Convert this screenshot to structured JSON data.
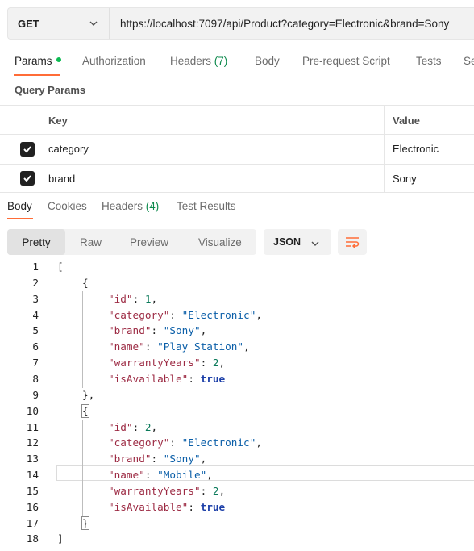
{
  "request": {
    "method": "GET",
    "url": "https://localhost:7097/api/Product?category=Electronic&brand=Sony"
  },
  "request_tabs": [
    {
      "label": "Params",
      "active": true
    },
    {
      "label": "Authorization"
    },
    {
      "label": "Headers",
      "count": "(7)"
    },
    {
      "label": "Body"
    },
    {
      "label": "Pre-request Script"
    },
    {
      "label": "Tests"
    },
    {
      "label": "Se"
    }
  ],
  "query_params": {
    "title": "Query Params",
    "columns": {
      "key": "Key",
      "value": "Value"
    },
    "rows": [
      {
        "checked": true,
        "key": "category",
        "value": "Electronic"
      },
      {
        "checked": true,
        "key": "brand",
        "value": "Sony"
      }
    ]
  },
  "response_tabs": [
    {
      "label": "Body",
      "active": true
    },
    {
      "label": "Cookies"
    },
    {
      "label": "Headers",
      "count": "(4)"
    },
    {
      "label": "Test Results"
    }
  ],
  "view_modes": [
    "Pretty",
    "Raw",
    "Preview",
    "Visualize"
  ],
  "format": "JSON",
  "icons": {
    "method_dropdown": "chevron-down-icon",
    "format_dropdown": "chevron-down-icon",
    "wrap": "wrap-lines-icon",
    "checkbox": "check-icon"
  },
  "colors": {
    "accent": "#ff6c37",
    "params_dot": "#0cbb52",
    "count": "#0e8a4d",
    "json_key": "#9c2a43",
    "json_string": "#0a5ea8",
    "json_number": "#0b7a5a",
    "json_bool": "#1c3fa8"
  },
  "code_lines": [
    {
      "n": "1",
      "text": "["
    },
    {
      "n": "2",
      "text": "{"
    },
    {
      "n": "3",
      "key": "\"id\"",
      "sep": ": ",
      "num": "1",
      "end": ","
    },
    {
      "n": "4",
      "key": "\"category\"",
      "sep": ": ",
      "str": "\"Electronic\"",
      "end": ","
    },
    {
      "n": "5",
      "key": "\"brand\"",
      "sep": ": ",
      "str": "\"Sony\"",
      "end": ","
    },
    {
      "n": "6",
      "key": "\"name\"",
      "sep": ": ",
      "str": "\"Play Station\"",
      "end": ","
    },
    {
      "n": "7",
      "key": "\"warrantyYears\"",
      "sep": ": ",
      "num": "2",
      "end": ","
    },
    {
      "n": "8",
      "key": "\"isAvailable\"",
      "sep": ": ",
      "bool": "true"
    },
    {
      "n": "9",
      "text": "},"
    },
    {
      "n": "10",
      "text": "{"
    },
    {
      "n": "11",
      "key": "\"id\"",
      "sep": ": ",
      "num": "2",
      "end": ","
    },
    {
      "n": "12",
      "key": "\"category\"",
      "sep": ": ",
      "str": "\"Electronic\"",
      "end": ","
    },
    {
      "n": "13",
      "key": "\"brand\"",
      "sep": ": ",
      "str": "\"Sony\"",
      "end": ","
    },
    {
      "n": "14",
      "key": "\"name\"",
      "sep": ": ",
      "str": "\"Mobile\"",
      "end": ","
    },
    {
      "n": "15",
      "key": "\"warrantyYears\"",
      "sep": ": ",
      "num": "2",
      "end": ","
    },
    {
      "n": "16",
      "key": "\"isAvailable\"",
      "sep": ": ",
      "bool": "true"
    },
    {
      "n": "17",
      "text": "}"
    },
    {
      "n": "18",
      "text": "]"
    }
  ]
}
